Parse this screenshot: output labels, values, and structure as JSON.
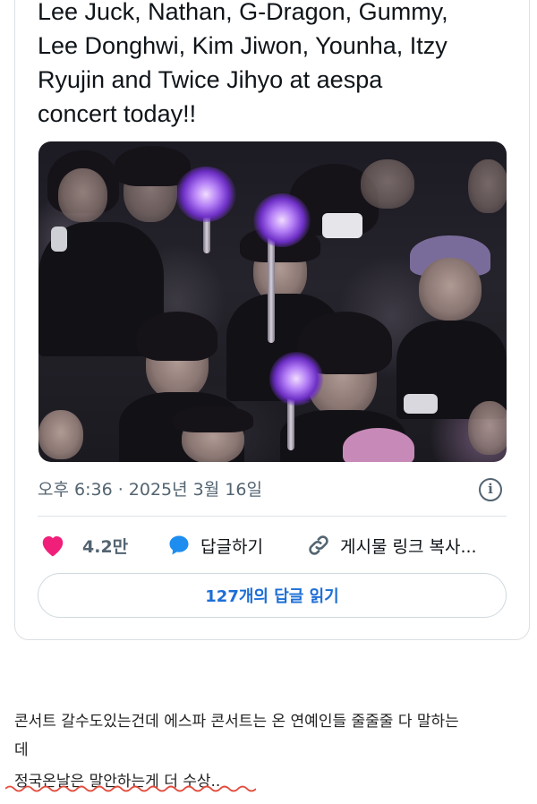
{
  "tweet": {
    "text": "Lee Juck, Nathan, G-Dragon, Gummy,\nLee Donghwi, Kim Jiwon, Younha, Itzy\nRyujin and Twice Jihyo at aespa\nconcert today!!",
    "timestamp": "오후 6:36 · 2025년 3월 16일",
    "photo_icon": "concert-crowd-photo"
  },
  "actions": {
    "like_count": "4.2만",
    "reply_label": "답글하기",
    "copy_link_label": "게시물 링크 복사..."
  },
  "replies_button_label": "127개의 답글 읽기",
  "comment": {
    "line1": "콘서트 갈수도있는건데 에스파 콘서트는 온 연예인들 줄줄줄 다 말하는",
    "line2": "데",
    "line3": "정국온날은 말안하는게 더 수상.."
  },
  "colors": {
    "heart": "#f0207a",
    "bubble": "#1d8ef0",
    "link_button_text": "#1d6fd6",
    "squiggle": "#e24a3b"
  }
}
